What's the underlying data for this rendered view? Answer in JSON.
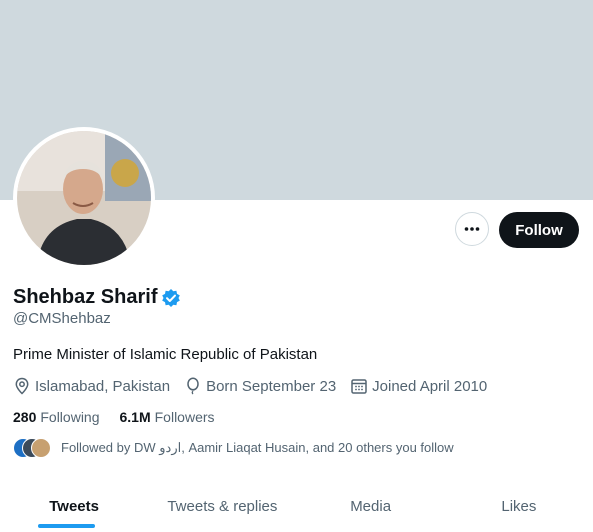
{
  "profile": {
    "name": "Shehbaz Sharif",
    "handle": "@CMShehbaz",
    "bio": "Prime Minister of Islamic Republic of Pakistan",
    "location": "Islamabad, Pakistan",
    "born": "Born September 23",
    "joined": "Joined April 2010"
  },
  "actions": {
    "follow_label": "Follow"
  },
  "stats": {
    "following_count": "280",
    "following_label": "Following",
    "followers_count": "6.1M",
    "followers_label": "Followers"
  },
  "followed_by": "Followed by DW اردو, Aamir Liaqat Husain, and 20 others you follow",
  "tabs": [
    {
      "label": "Tweets",
      "active": true
    },
    {
      "label": "Tweets & replies",
      "active": false
    },
    {
      "label": "Media",
      "active": false
    },
    {
      "label": "Likes",
      "active": false
    }
  ],
  "colors": {
    "banner": "#cfd9de",
    "accent": "#1d9bf0",
    "verified": "#1d9bf0"
  },
  "icons": [
    "more-icon",
    "verified-badge-icon",
    "location-icon",
    "balloon-icon",
    "calendar-icon"
  ]
}
